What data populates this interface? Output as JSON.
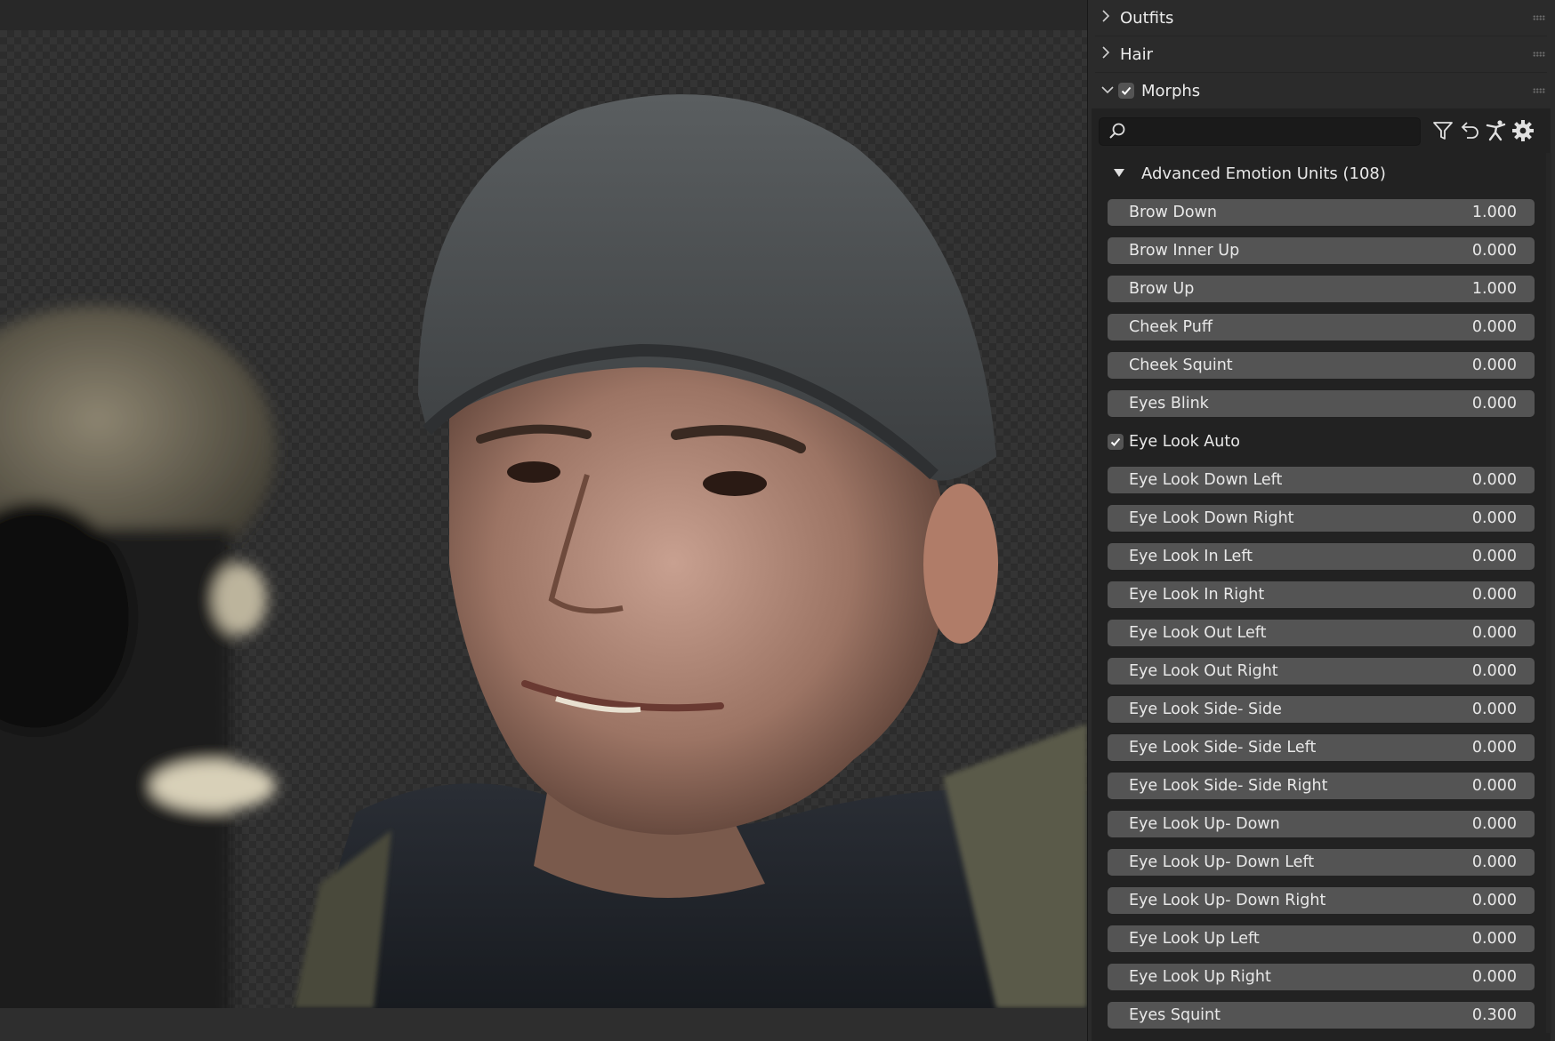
{
  "panel": {
    "sections": [
      {
        "label": "Outfits",
        "expanded": false
      },
      {
        "label": "Hair",
        "expanded": false
      },
      {
        "label": "Morphs",
        "expanded": true,
        "checked": true
      }
    ],
    "search": {
      "placeholder": "",
      "value": ""
    },
    "toolbar_icons": [
      "filter-icon",
      "reset-icon",
      "pose-figure-icon",
      "settings-gear-icon"
    ],
    "group": {
      "label": "Advanced Emotion Units (108)",
      "expanded": true
    },
    "rows": [
      {
        "type": "slider",
        "label": "Brow Down",
        "value": "1.000"
      },
      {
        "type": "slider",
        "label": "Brow Inner Up",
        "value": "0.000"
      },
      {
        "type": "slider",
        "label": "Brow Up",
        "value": "1.000"
      },
      {
        "type": "slider",
        "label": "Cheek Puff",
        "value": "0.000"
      },
      {
        "type": "slider",
        "label": "Cheek Squint",
        "value": "0.000"
      },
      {
        "type": "slider",
        "label": "Eyes Blink",
        "value": "0.000"
      },
      {
        "type": "checkbox",
        "label": "Eye Look Auto",
        "checked": true
      },
      {
        "type": "slider",
        "label": "Eye Look Down Left",
        "value": "0.000"
      },
      {
        "type": "slider",
        "label": "Eye Look Down Right",
        "value": "0.000"
      },
      {
        "type": "slider",
        "label": "Eye Look In Left",
        "value": "0.000"
      },
      {
        "type": "slider",
        "label": "Eye Look In Right",
        "value": "0.000"
      },
      {
        "type": "slider",
        "label": "Eye Look Out Left",
        "value": "0.000"
      },
      {
        "type": "slider",
        "label": "Eye Look Out Right",
        "value": "0.000"
      },
      {
        "type": "slider",
        "label": "Eye Look Side- Side",
        "value": "0.000"
      },
      {
        "type": "slider",
        "label": "Eye Look Side- Side Left",
        "value": "0.000"
      },
      {
        "type": "slider",
        "label": "Eye Look Side- Side Right",
        "value": "0.000"
      },
      {
        "type": "slider",
        "label": "Eye Look Up- Down",
        "value": "0.000"
      },
      {
        "type": "slider",
        "label": "Eye Look Up- Down Left",
        "value": "0.000"
      },
      {
        "type": "slider",
        "label": "Eye Look Up- Down Right",
        "value": "0.000"
      },
      {
        "type": "slider",
        "label": "Eye Look Up Left",
        "value": "0.000"
      },
      {
        "type": "slider",
        "label": "Eye Look Up Right",
        "value": "0.000"
      },
      {
        "type": "slider",
        "label": "Eyes Squint",
        "value": "0.300"
      }
    ]
  },
  "colors": {
    "panel_bg": "#2b2b2b",
    "slider_bg": "#545454",
    "text": "#e8e8e8",
    "viewport_bg": "#343434"
  }
}
